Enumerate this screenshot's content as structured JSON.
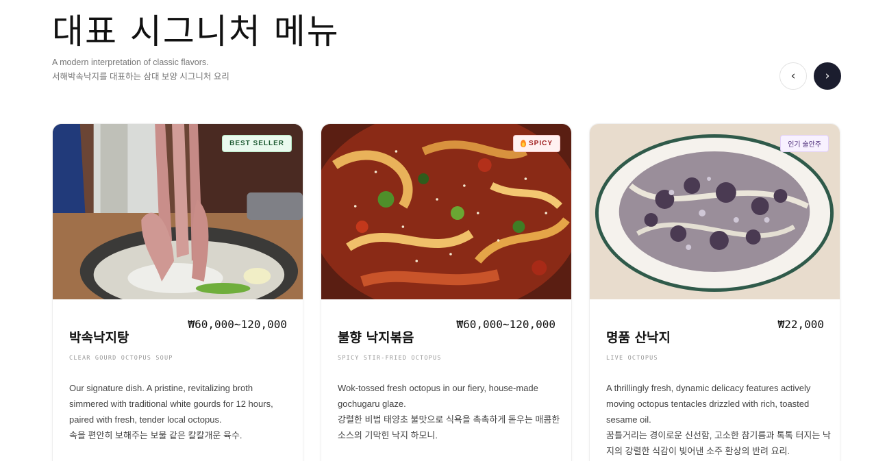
{
  "header": {
    "title": "대표 시그니처 메뉴",
    "subtitle_en": "A modern interpretation of classic flavors.",
    "subtitle_ko": "서해박속낙지를 대표하는 삼대 보양 시그니처 요리"
  },
  "nav": {
    "prev_label": "‹",
    "prev_icon": "chevron-left-icon",
    "next_label": "›",
    "next_icon": "chevron-right-icon"
  },
  "colors": {
    "nav_active": "#1b1d2e",
    "badge_best_bg": "#eafaef",
    "badge_spicy_bg": "#fff1f1",
    "badge_hot_bg": "#f8f1ff"
  },
  "cards": [
    {
      "badge": "BEST SELLER",
      "price": "₩60,000~120,000",
      "name": "박속낙지탕",
      "name_en": "CLEAR GOURD OCTOPUS SOUP",
      "desc": [
        "Our signature dish. A pristine, revitalizing broth",
        "simmered with traditional white gourds for 12 hours,",
        "paired with fresh, tender local octopus.",
        "속을 편안히 보해주는 보물 같은 칼칼개운 육수."
      ]
    },
    {
      "badge": "SPICY",
      "badge_icon": "flame-icon",
      "price": "₩60,000~120,000",
      "name": "불향 낙지볶음",
      "name_en": "SPICY STIR-FRIED OCTOPUS",
      "desc": [
        "Wok-tossed fresh octopus in our fiery, house-made",
        "gochugaru glaze.",
        "강렬한 비법 태양초 불맛으로 식욕을 촉촉하게 돋우는 매콤한",
        "소스의 기막힌 낙지 하모니."
      ]
    },
    {
      "badge": "인기 술안주",
      "price": "₩22,000",
      "name": "명품 산낙지",
      "name_en": "LIVE OCTOPUS",
      "desc": [
        "A thrillingly fresh, dynamic delicacy features actively",
        "moving octopus tentacles drizzled with rich, toasted",
        "sesame oil.",
        "꿈틀거리는 경이로운 신선함, 고소한 참기름과 톡톡 터지는 낙",
        "지의 강렬한 식감이 빚어낸 소주 환상의 반려 요리."
      ]
    }
  ]
}
